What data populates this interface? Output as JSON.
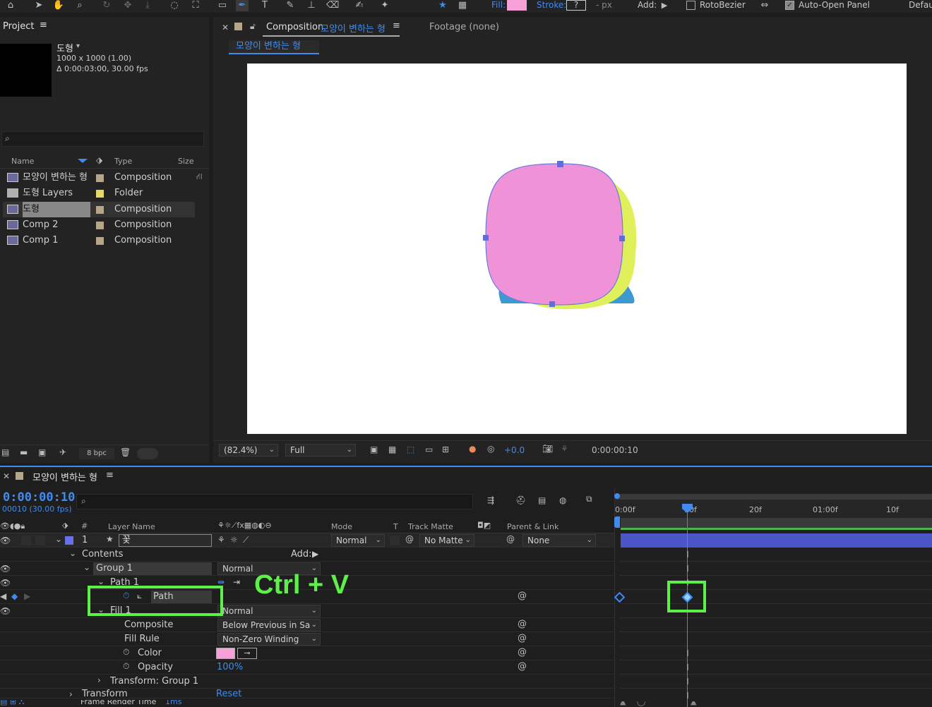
{
  "toolbar": {
    "fill_label": "Fill:",
    "fill_color": "#f7a1d8",
    "stroke_label": "Stroke:",
    "stroke_value": "?",
    "stroke_width": "- px",
    "add_label": "Add:",
    "rotobezier_label": "RotoBezier",
    "auto_open_label": "Auto-Open Panel",
    "default_label": "Defau"
  },
  "project": {
    "tab_label": "Project",
    "item_name": "도형",
    "item_size": "1000 x 1000 (1.00)",
    "item_duration": "Δ 0:00:03:00, 30.00 fps",
    "search_placeholder": "",
    "columns": {
      "name": "Name",
      "type": "Type",
      "size": "Size"
    },
    "items": [
      {
        "name": "모양이 변하는 형",
        "type": "Composition",
        "icon": "composition-icon",
        "label_color": "#b5a58a"
      },
      {
        "name": "도형 Layers",
        "type": "Folder",
        "icon": "folder-icon",
        "label_color": "#e4d86b"
      },
      {
        "name": "도형",
        "type": "Composition",
        "icon": "composition-icon",
        "label_color": "#b5a58a"
      },
      {
        "name": "Comp 2",
        "type": "Composition",
        "icon": "composition-icon",
        "label_color": "#b5a58a"
      },
      {
        "name": "Comp 1",
        "type": "Composition",
        "icon": "composition-icon",
        "label_color": "#b5a58a"
      }
    ],
    "bpc_label": "8 bpc"
  },
  "composition": {
    "tab_prefix": "Composition",
    "tab_name": "모양이 변하는 형",
    "footage_label": "Footage (none)",
    "breadcrumb": "모양이 변하는 형",
    "zoom": "(82.4%)",
    "resolution": "Full",
    "exposure": "+0.0",
    "timecode": "0:00:00:10",
    "colors": {
      "pink": "#ef92d8",
      "yellow": "#dff05a",
      "blue": "#3d9ad0"
    }
  },
  "timeline": {
    "tab_name": "모양이 변하는 형",
    "current_time": "0:00:00:10",
    "frame_info": "00010 (30.00 fps)",
    "columns": {
      "layer_name": "Layer Name",
      "mode": "Mode",
      "t": "T",
      "track_matte": "Track Matte",
      "parent": "Parent & Link"
    },
    "ruler": [
      "0:00f",
      "10f",
      "20f",
      "01:00f",
      "10f"
    ],
    "layer": {
      "number": "1",
      "name": "꽃",
      "mode": "Normal",
      "matte": "No Matte",
      "parent": "None"
    },
    "contents_label": "Contents",
    "add_label": "Add:",
    "group_label": "Group 1",
    "group_mode": "Normal",
    "path1_label": "Path 1",
    "path_label": "Path",
    "fill1_label": "Fill 1",
    "fill_mode": "Normal",
    "composite_label": "Composite",
    "composite_value": "Below Previous in Sa",
    "fill_rule_label": "Fill Rule",
    "fill_rule_value": "Non-Zero Winding",
    "color_label": "Color",
    "opacity_label": "Opacity",
    "opacity_value": "100%",
    "transform_group_label": "Transform: Group 1",
    "transform_label": "Transform",
    "reset_label": "Reset",
    "frame_render_label": "Frame Render Time",
    "frame_render_value": "1ms",
    "annotation": "Ctrl + V",
    "highlight_color": "#5df048"
  }
}
